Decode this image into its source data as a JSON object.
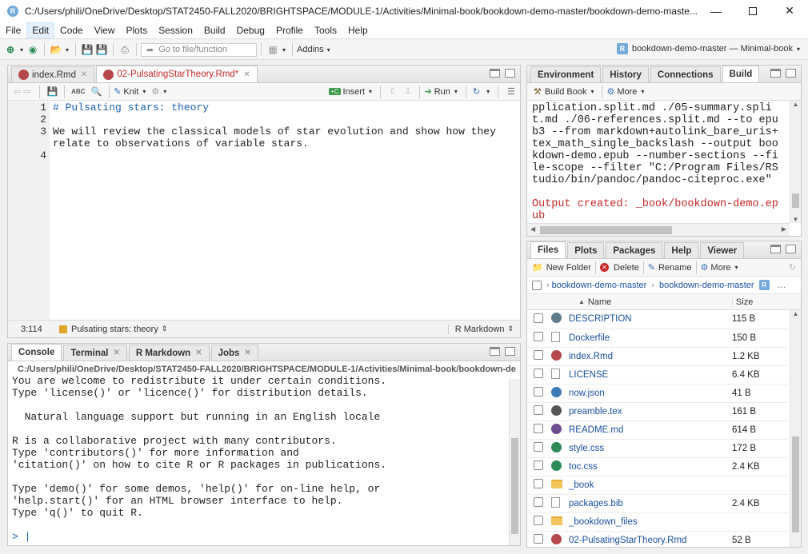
{
  "window": {
    "title": "C:/Users/phili/OneDrive/Desktop/STAT2450-FALL2020/BRIGHTSPACE/MODULE-1/Activities/Minimal-book/bookdown-demo-master/bookdown-demo-maste...",
    "app_icon": "R"
  },
  "menu": [
    "File",
    "Edit",
    "Code",
    "View",
    "Plots",
    "Session",
    "Build",
    "Debug",
    "Profile",
    "Tools",
    "Help"
  ],
  "toolbar": {
    "goto_placeholder": "Go to file/function",
    "addins": "Addins",
    "project": "bookdown-demo-master — Minimal-book"
  },
  "source": {
    "tabs": [
      {
        "label": "index.Rmd"
      },
      {
        "label": "02-PulsatingStarTheory.Rmd*"
      }
    ],
    "toolbar": {
      "abc": "ABC",
      "knit": "Knit",
      "insert": "Insert",
      "run": "Run"
    },
    "line_numbers": [
      "1",
      "2",
      "3",
      "",
      "4"
    ],
    "lines": [
      "# Pulsating stars: theory",
      "",
      "We will review the classical models of star evolution and show how they",
      "relate to observations of variable stars.",
      ""
    ],
    "status": {
      "position": "3:114",
      "section": "Pulsating stars: theory",
      "mode": "R Markdown"
    }
  },
  "console": {
    "tabs": [
      "Console",
      "Terminal",
      "R Markdown",
      "Jobs"
    ],
    "path": "C:/Users/phili/OneDrive/Desktop/STAT2450-FALL2020/BRIGHTSPACE/MODULE-1/Activities/Minimal-book/bookdown-de",
    "lines": [
      "You are welcome to redistribute it under certain conditions.",
      "Type 'license()' or 'licence()' for distribution details.",
      "",
      "  Natural language support but running in an English locale",
      "",
      "R is a collaborative project with many contributors.",
      "Type 'contributors()' for more information and",
      "'citation()' on how to cite R or R packages in publications.",
      "",
      "Type 'demo()' for some demos, 'help()' for on-line help, or",
      "'help.start()' for an HTML browser interface to help.",
      "Type 'q()' to quit R.",
      "",
      ""
    ],
    "prompt": ">"
  },
  "env": {
    "tabs": [
      "Environment",
      "History",
      "Connections",
      "Build"
    ],
    "toolbar": {
      "build_book": "Build Book",
      "more": "More"
    },
    "output": [
      "pplication.split.md ./05-summary.spli",
      "t.md ./06-references.split.md --to epu",
      "b3 --from markdown+autolink_bare_uris+",
      "tex_math_single_backslash --output boo",
      "kdown-demo.epub --number-sections --fi",
      "le-scope --filter \"C:/Program Files/RS",
      "tudio/bin/pandoc/pandoc-citeproc.exe\"",
      ""
    ],
    "result": [
      "Output created: _book/bookdown-demo.ep",
      "ub"
    ]
  },
  "files": {
    "tabs": [
      "Files",
      "Plots",
      "Packages",
      "Help",
      "Viewer"
    ],
    "toolbar": {
      "new_folder": "New Folder",
      "delete": "Delete",
      "rename": "Rename",
      "more": "More"
    },
    "breadcrumb": [
      "bookdown-demo-master",
      "bookdown-demo-master"
    ],
    "columns": {
      "name": "Name",
      "size": "Size"
    },
    "rows": [
      {
        "name": "DESCRIPTION",
        "size": "115 B",
        "icon": "description-icon",
        "color": "#607d8b"
      },
      {
        "name": "Dockerfile",
        "size": "150 B",
        "icon": "file-icon",
        "color": "#ffffff"
      },
      {
        "name": "index.Rmd",
        "size": "1.2 KB",
        "icon": "rmd-icon",
        "color": "#b5484b"
      },
      {
        "name": "LICENSE",
        "size": "6.4 KB",
        "icon": "file-icon",
        "color": "#ffffff"
      },
      {
        "name": "now.json",
        "size": "41 B",
        "icon": "json-icon",
        "color": "#3d7ab8"
      },
      {
        "name": "preamble.tex",
        "size": "161 B",
        "icon": "tex-icon",
        "color": "#555555"
      },
      {
        "name": "README.md",
        "size": "614 B",
        "icon": "md-icon",
        "color": "#6d4c8f"
      },
      {
        "name": "style.css",
        "size": "172 B",
        "icon": "css-icon",
        "color": "#2e8b57"
      },
      {
        "name": "toc.css",
        "size": "2.4 KB",
        "icon": "css-icon",
        "color": "#2e8b57"
      },
      {
        "name": "_book",
        "size": "",
        "icon": "folder-icon",
        "color": "#f2c55c"
      },
      {
        "name": "packages.bib",
        "size": "2.4 KB",
        "icon": "file-icon",
        "color": "#ffffff"
      },
      {
        "name": "_bookdown_files",
        "size": "",
        "icon": "folder-icon",
        "color": "#f2c55c"
      },
      {
        "name": "02-PulsatingStarTheory.Rmd",
        "size": "52 B",
        "icon": "rmd-icon",
        "color": "#b5484b"
      }
    ]
  }
}
